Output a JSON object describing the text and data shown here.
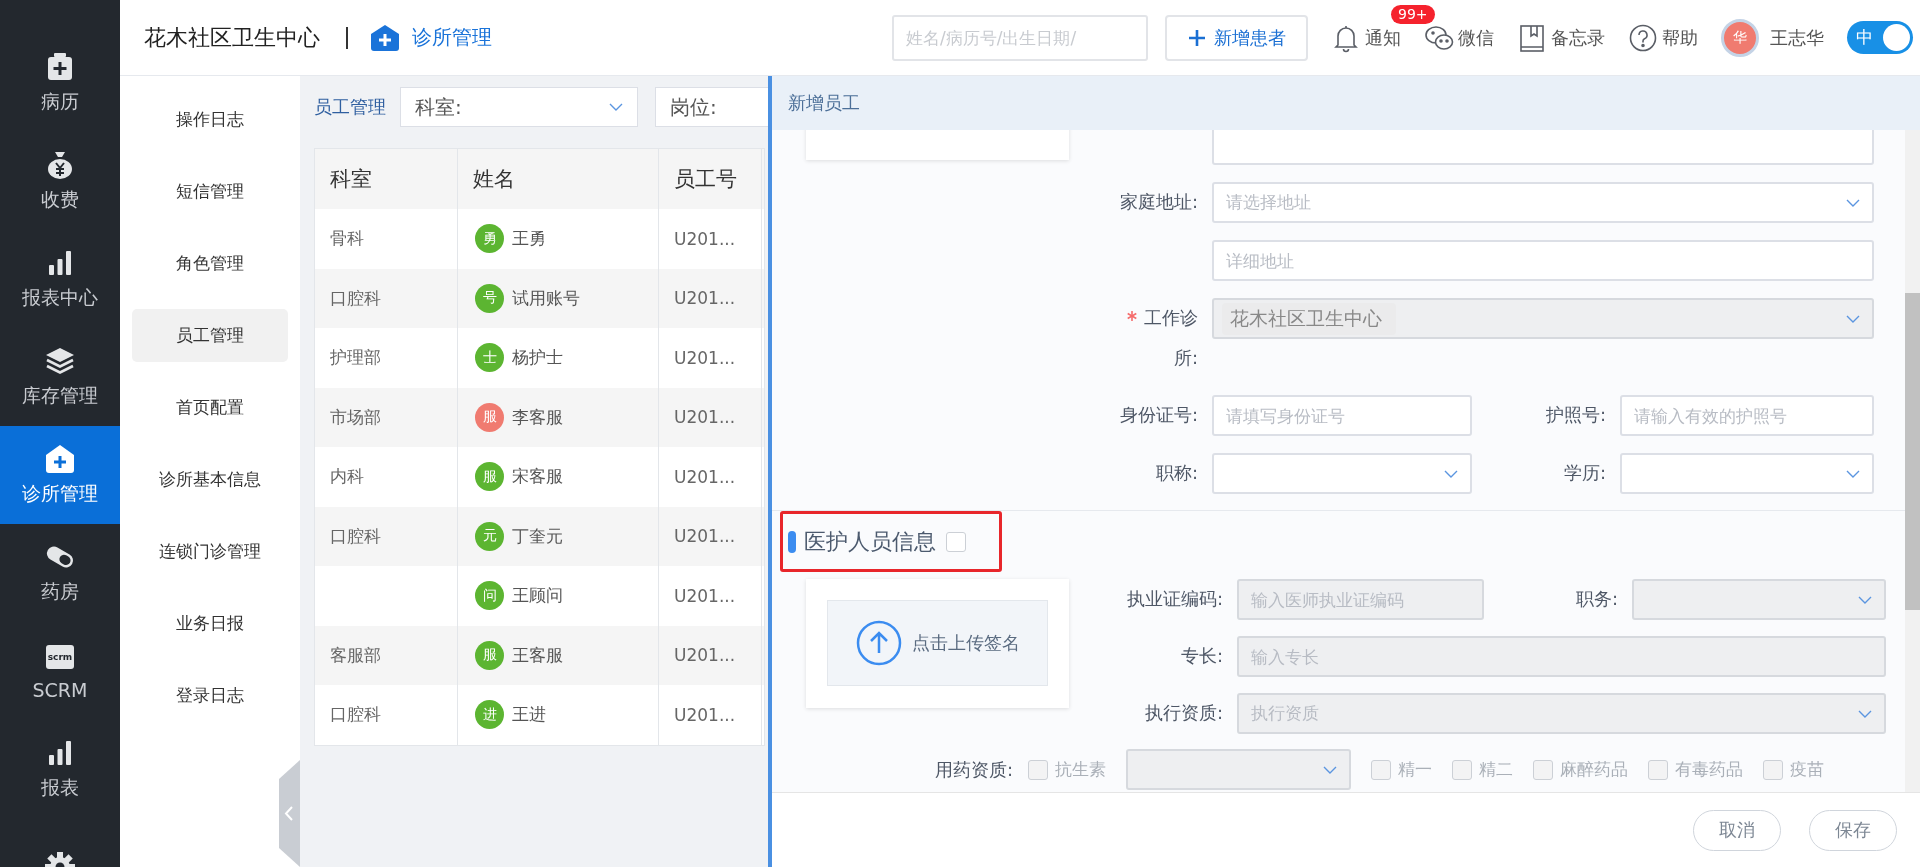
{
  "sidebar": {
    "items": [
      {
        "kind": "record",
        "label": "病历",
        "selected": false
      },
      {
        "kind": "money",
        "label": "收费",
        "selected": false
      },
      {
        "kind": "bars",
        "label": "报表中心",
        "selected": false
      },
      {
        "kind": "layers",
        "label": "库存管理",
        "selected": false
      },
      {
        "kind": "clinic",
        "label": "诊所管理",
        "selected": true
      },
      {
        "kind": "pill",
        "label": "药房",
        "selected": false
      },
      {
        "kind": "scrm",
        "icon_text": "scrm",
        "label": "SCRM",
        "selected": false
      },
      {
        "kind": "bars",
        "label": "报表",
        "selected": false
      },
      {
        "kind": "gear",
        "selected": false
      }
    ]
  },
  "header": {
    "clinic": "花木社区卫生中心",
    "module": "诊所管理",
    "search": {
      "placeholder": "姓名/病历号/出生日期/"
    },
    "new_button": "新增患者",
    "tools": [
      {
        "kind": "bell",
        "label": "通知",
        "badge": "99+"
      },
      {
        "kind": "chat",
        "label": "微信"
      },
      {
        "kind": "book",
        "label": "备忘录"
      },
      {
        "kind": "help",
        "label": "帮助"
      }
    ],
    "user": {
      "avatar": "华",
      "name": "王志华"
    },
    "lang_toggle": {
      "label": "中",
      "on": true
    }
  },
  "subnav": {
    "items": [
      {
        "label": "操作日志",
        "selected": false
      },
      {
        "label": "短信管理",
        "selected": false
      },
      {
        "label": "角色管理",
        "selected": false
      },
      {
        "label": "员工管理",
        "selected": true
      },
      {
        "label": "首页配置",
        "selected": false
      },
      {
        "label": "诊所基本信息",
        "selected": false
      },
      {
        "label": "连锁门诊管理",
        "selected": false
      },
      {
        "label": "业务日报",
        "selected": false
      },
      {
        "label": "登录日志",
        "selected": false
      }
    ]
  },
  "staff": {
    "title": "员工管理",
    "filters": [
      {
        "label": "科室:"
      },
      {
        "label": "岗位:"
      }
    ],
    "table": {
      "columns": [
        "科室",
        "姓名",
        "员工号"
      ],
      "rows": [
        {
          "dept": "骨科",
          "avatar": "勇",
          "color": "#5cb531",
          "name": "王勇",
          "id": "U201..."
        },
        {
          "dept": "口腔科",
          "avatar": "号",
          "color": "#5cb531",
          "name": "试用账号",
          "id": "U201..."
        },
        {
          "dept": "护理部",
          "avatar": "士",
          "color": "#5cb531",
          "name": "杨护士",
          "id": "U201..."
        },
        {
          "dept": "市场部",
          "avatar": "服",
          "color": "#f07b70",
          "name": "李客服",
          "id": "U201..."
        },
        {
          "dept": "内科",
          "avatar": "服",
          "color": "#5cb531",
          "name": "宋客服",
          "id": "U201..."
        },
        {
          "dept": "口腔科",
          "avatar": "元",
          "color": "#5cb531",
          "name": "丁奎元",
          "id": "U201..."
        },
        {
          "avatar": "问",
          "color": "#5cb531",
          "name": "王顾问",
          "id": "U201..."
        },
        {
          "dept": "客服部",
          "avatar": "服",
          "color": "#5cb531",
          "name": "王客服",
          "id": "U201..."
        },
        {
          "dept": "口腔科",
          "avatar": "进",
          "color": "#5cb531",
          "name": "王进",
          "id": "U201..."
        }
      ]
    }
  },
  "panel": {
    "title": "新增员工",
    "basic": {
      "rows": [
        {
          "fields": [
            {
              "kind": "input"
            }
          ]
        },
        {
          "fields": [
            {
              "kind": "select",
              "label": "家庭地址:",
              "placeholder": "请选择地址"
            }
          ]
        },
        {
          "fields": [
            {
              "kind": "input",
              "placeholder": "详细地址"
            }
          ]
        },
        {
          "fields": [
            {
              "kind": "select",
              "label": "工作诊所:",
              "required": true,
              "disabled": true,
              "tag": "花木社区卫生中心"
            }
          ]
        },
        {
          "fields": [
            {
              "kind": "input",
              "label": "身份证号:",
              "placeholder": "请填写身份证号"
            },
            {
              "kind": "input",
              "label": "护照号:",
              "placeholder": "请输入有效的护照号"
            }
          ]
        },
        {
          "fields": [
            {
              "kind": "select",
              "label": "职称:"
            },
            {
              "kind": "select",
              "label": "学历:"
            }
          ]
        }
      ]
    },
    "medical": {
      "title": "医护人员信息",
      "checked": false,
      "upload": "点击上传签名",
      "rows": [
        {
          "fields": [
            {
              "kind": "input",
              "label": "执业证编码:",
              "placeholder": "输入医师执业证编码"
            },
            {
              "kind": "select",
              "label": "职务:"
            }
          ]
        },
        {
          "fields": [
            {
              "kind": "input",
              "label": "专长:",
              "placeholder": "输入专长"
            }
          ]
        },
        {
          "fields": [
            {
              "kind": "select",
              "label": "执行资质:",
              "placeholder": "执行资质"
            }
          ]
        }
      ],
      "drug_label": "用药资质:",
      "drug_options": [
        {
          "kind": "checkbox",
          "label": "抗生素",
          "checked": false
        },
        {
          "kind": "select"
        },
        {
          "kind": "checkbox",
          "label": "精一",
          "checked": false
        },
        {
          "kind": "checkbox",
          "label": "精二",
          "checked": false
        },
        {
          "kind": "checkbox",
          "label": "麻醉药品",
          "checked": false
        },
        {
          "kind": "checkbox",
          "label": "有毒药品",
          "checked": false
        },
        {
          "kind": "checkbox",
          "label": "疫苗",
          "checked": false
        }
      ]
    },
    "buttons": [
      "取消",
      "保存"
    ]
  }
}
